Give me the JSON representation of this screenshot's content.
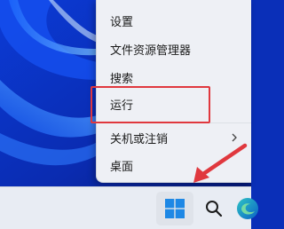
{
  "context_menu": {
    "items": [
      {
        "label": "设置"
      },
      {
        "label": "文件资源管理器"
      },
      {
        "label": "搜索"
      },
      {
        "label": "运行"
      },
      {
        "label": "关机或注销",
        "has_submenu": true
      },
      {
        "label": "桌面"
      }
    ]
  },
  "taskbar": {
    "icons": [
      "windows-start-icon",
      "search-icon",
      "edge-icon"
    ]
  },
  "colors": {
    "highlight": "#e0383e",
    "wallpaper": "#0a2fb8",
    "menu_bg": "#eef0f5",
    "start_blue": "#1e88e5"
  }
}
